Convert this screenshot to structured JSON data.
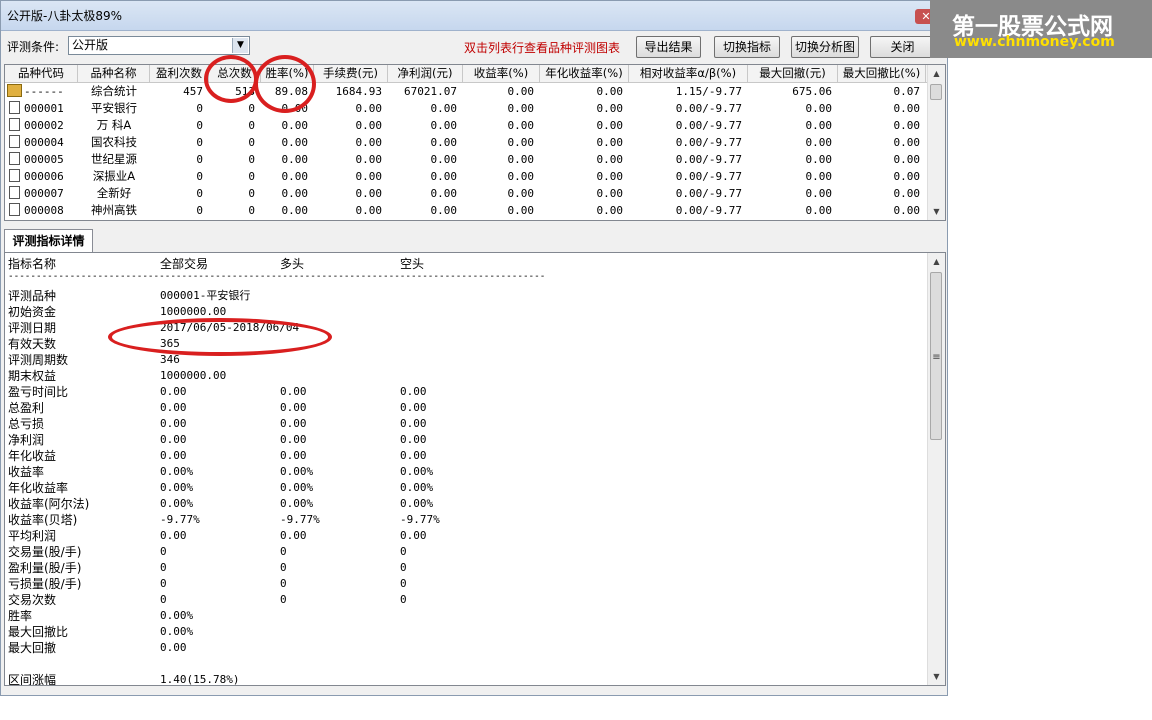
{
  "window": {
    "title": "公开版-八卦太极89%"
  },
  "toolbar": {
    "condition_label": "评测条件:",
    "condition_value": "公开版",
    "hint": "双击列表行查看品种评测图表",
    "export_label": "导出结果",
    "switch_indicator_label": "切换指标",
    "switch_chart_label": "切换分析图",
    "close_label": "关闭"
  },
  "table": {
    "headers": [
      "品种代码",
      "品种名称",
      "盈利次数",
      "总次数",
      "胜率(%)",
      "手续费(元)",
      "净利润(元)",
      "收益率(%)",
      "年化收益率(%)",
      "相对收益率α/β(%)",
      "最大回撤(元)",
      "最大回撤比(%)"
    ],
    "rows": [
      [
        "------",
        "综合统计",
        "457",
        "513",
        "89.08",
        "1684.93",
        "67021.07",
        "0.00",
        "0.00",
        "1.15/-9.77",
        "675.06",
        "0.07"
      ],
      [
        "000001",
        "平安银行",
        "0",
        "0",
        "0.00",
        "0.00",
        "0.00",
        "0.00",
        "0.00",
        "0.00/-9.77",
        "0.00",
        "0.00"
      ],
      [
        "000002",
        "万 科A",
        "0",
        "0",
        "0.00",
        "0.00",
        "0.00",
        "0.00",
        "0.00",
        "0.00/-9.77",
        "0.00",
        "0.00"
      ],
      [
        "000004",
        "国农科技",
        "0",
        "0",
        "0.00",
        "0.00",
        "0.00",
        "0.00",
        "0.00",
        "0.00/-9.77",
        "0.00",
        "0.00"
      ],
      [
        "000005",
        "世纪星源",
        "0",
        "0",
        "0.00",
        "0.00",
        "0.00",
        "0.00",
        "0.00",
        "0.00/-9.77",
        "0.00",
        "0.00"
      ],
      [
        "000006",
        "深振业A",
        "0",
        "0",
        "0.00",
        "0.00",
        "0.00",
        "0.00",
        "0.00",
        "0.00/-9.77",
        "0.00",
        "0.00"
      ],
      [
        "000007",
        "全新好",
        "0",
        "0",
        "0.00",
        "0.00",
        "0.00",
        "0.00",
        "0.00",
        "0.00/-9.77",
        "0.00",
        "0.00"
      ],
      [
        "000008",
        "神州高铁",
        "0",
        "0",
        "0.00",
        "0.00",
        "0.00",
        "0.00",
        "0.00",
        "0.00/-9.77",
        "0.00",
        "0.00"
      ]
    ]
  },
  "detail": {
    "tab_label": "评测指标详情",
    "headers": [
      "指标名称",
      "全部交易",
      "多头",
      "空头"
    ],
    "separator": "------------------------------------------------------------------------------------------------",
    "rows": [
      [
        "评测品种",
        "000001-平安银行",
        "",
        ""
      ],
      [
        "初始资金",
        "1000000.00",
        "",
        ""
      ],
      [
        "评测日期",
        "2017/06/05-2018/06/04",
        "",
        ""
      ],
      [
        "有效天数",
        "365",
        "",
        ""
      ],
      [
        "评测周期数",
        "346",
        "",
        ""
      ],
      [
        "期末权益",
        "1000000.00",
        "",
        ""
      ],
      [
        "盈亏时间比",
        "0.00",
        "0.00",
        "0.00"
      ],
      [
        "总盈利",
        "0.00",
        "0.00",
        "0.00"
      ],
      [
        "总亏损",
        "0.00",
        "0.00",
        "0.00"
      ],
      [
        "净利润",
        "0.00",
        "0.00",
        "0.00"
      ],
      [
        "年化收益",
        "0.00",
        "0.00",
        "0.00"
      ],
      [
        "收益率",
        "0.00%",
        "0.00%",
        "0.00%"
      ],
      [
        "年化收益率",
        "0.00%",
        "0.00%",
        "0.00%"
      ],
      [
        "收益率(阿尔法)",
        "0.00%",
        "0.00%",
        "0.00%"
      ],
      [
        "收益率(贝塔)",
        "-9.77%",
        "-9.77%",
        "-9.77%"
      ],
      [
        "平均利润",
        "0.00",
        "0.00",
        "0.00"
      ],
      [
        "交易量(股/手)",
        "0",
        "0",
        "0"
      ],
      [
        "盈利量(股/手)",
        "0",
        "0",
        "0"
      ],
      [
        "亏损量(股/手)",
        "0",
        "0",
        "0"
      ],
      [
        "交易次数",
        "0",
        "0",
        "0"
      ],
      [
        "胜率",
        "0.00%",
        "",
        ""
      ],
      [
        "最大回撤比",
        "0.00%",
        "",
        ""
      ],
      [
        "最大回撤",
        "0.00",
        "",
        ""
      ],
      [
        "",
        "",
        " ",
        ""
      ],
      [
        "区间涨幅",
        "1.40(15.78%)",
        "",
        ""
      ]
    ]
  },
  "watermark": {
    "line1": "第一股票公式网",
    "line2": "www.chnmoney.com"
  },
  "colors": {
    "hint": "#c00000",
    "annotation_circle": "#d91f1f",
    "watermark_bg": "#8a8a8a",
    "watermark_url": "#ffe000"
  }
}
